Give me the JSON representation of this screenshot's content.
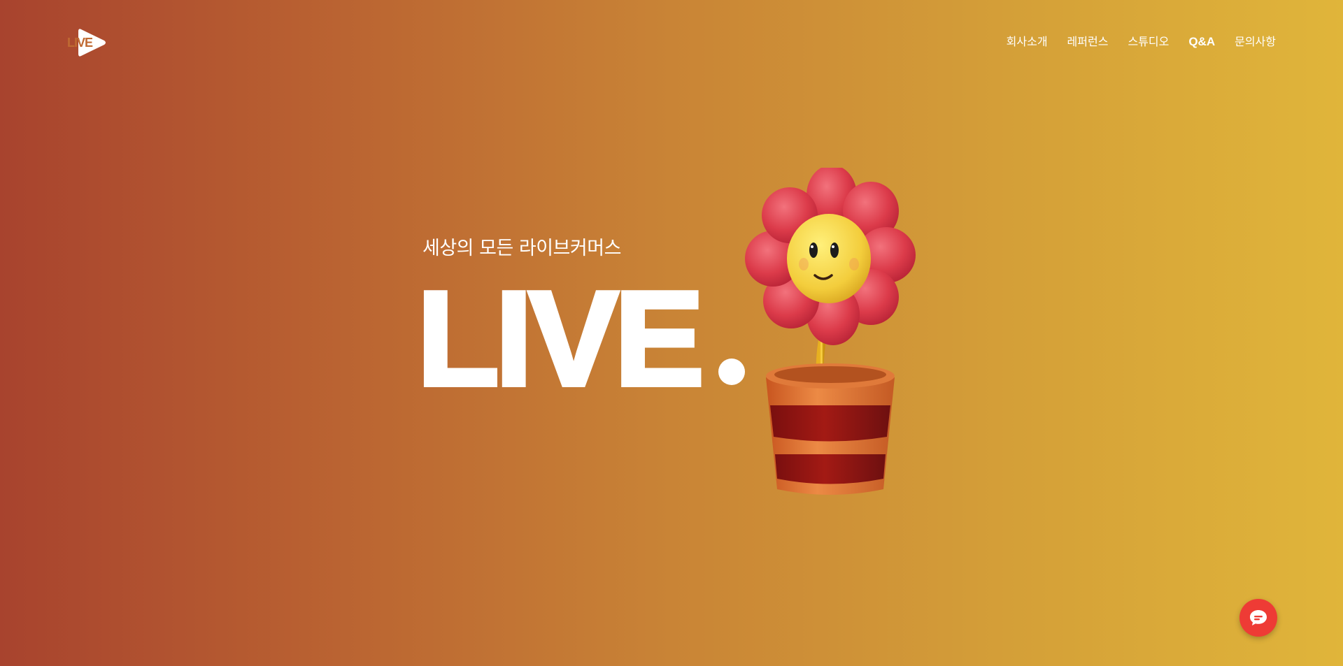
{
  "brand": {
    "logo_text": "LIVE",
    "logo_icon": "play-triangle-icon"
  },
  "nav": {
    "items": [
      {
        "label": "회사소개"
      },
      {
        "label": "레퍼런스"
      },
      {
        "label": "스튜디오"
      },
      {
        "label": "Q&A"
      },
      {
        "label": "문의사항"
      }
    ]
  },
  "hero": {
    "tagline": "세상의 모든 라이브커머스",
    "headline": "LIVE",
    "illustration": "smiling-flower-pot-illustration"
  },
  "chat": {
    "icon": "chat-bubble-icon"
  },
  "colors": {
    "gradient_start": "#a8432e",
    "gradient_end": "#e0b53a",
    "text": "#ffffff",
    "chat_button": "#ee3b35"
  }
}
